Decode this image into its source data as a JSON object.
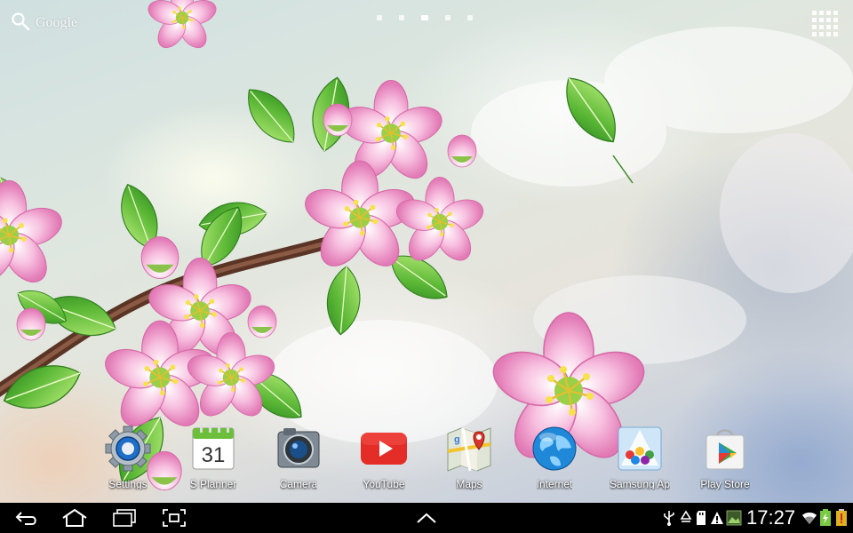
{
  "search": {
    "label": "Google",
    "icon": "search-icon"
  },
  "home_pages": {
    "count": 5,
    "active_index": 2
  },
  "apps_button": {
    "icon": "apps-grid-icon"
  },
  "dock": [
    {
      "label": "Settings",
      "icon": "settings-gear-icon"
    },
    {
      "label": "S Planner",
      "icon": "calendar-icon",
      "icon_text": "31"
    },
    {
      "label": "Camera",
      "icon": "camera-icon"
    },
    {
      "label": "YouTube",
      "icon": "youtube-icon"
    },
    {
      "label": "Maps",
      "icon": "maps-icon"
    },
    {
      "label": "Internet",
      "icon": "globe-icon"
    },
    {
      "label": "Samsung Ap",
      "icon": "samsung-apps-icon"
    },
    {
      "label": "Play Store",
      "icon": "play-store-icon"
    }
  ],
  "navbar": {
    "buttons": [
      "back-icon",
      "home-icon",
      "recent-apps-icon",
      "screenshot-icon",
      "up-arrow-icon"
    ],
    "status_icons": [
      "usb-icon",
      "recycle-icon",
      "sd-card-icon",
      "warning-icon",
      "image-icon",
      "wifi-icon",
      "battery-charging-icon"
    ],
    "time": "17:27"
  },
  "colors": {
    "navbar": "#000000",
    "youtube_red": "#e52d27",
    "battery_green": "#7ac943",
    "leaf_green": "#5cb836",
    "blossom_pink": "#f2a6cf"
  }
}
